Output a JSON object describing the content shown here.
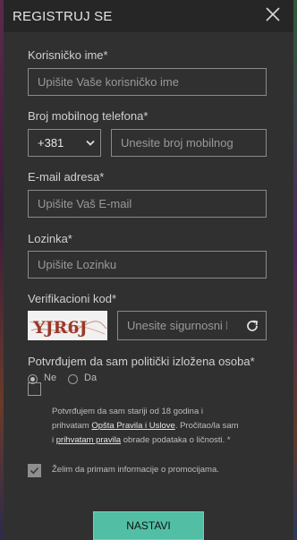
{
  "header": {
    "title": "REGISTRUJ SE"
  },
  "username": {
    "label": "Korisničko ime*",
    "placeholder": "Upišite Vaše korisničko ime"
  },
  "phone": {
    "label": "Broj mobilnog telefona*",
    "country_code": "+381",
    "placeholder": "Unesite broj mobilnog"
  },
  "email": {
    "label": "E-mail adresa*",
    "placeholder": "Upišite Vaš E-mail"
  },
  "password": {
    "label": "Lozinka*",
    "placeholder": "Upišite Lozinku"
  },
  "captcha": {
    "label": "Verifikacioni kod*",
    "image_text": "YJR6J",
    "placeholder": "Unesite sigurnosni kod"
  },
  "pep": {
    "label": "Potvrđujem da sam politički izložena osoba*",
    "option_no": "Ne",
    "option_yes": "Da",
    "selected": "Ne"
  },
  "terms": {
    "line1": "Potvrđujem da sam stariji od 18 godina i",
    "line2_prefix": "prihvatam ",
    "line2_link": "Opšta Pravila i Uslove",
    "line2_suffix": ". Pročitao/la sam",
    "line3_prefix": "i ",
    "line3_link": "prihvatam pravila",
    "line3_suffix": " obrade podataka o ličnosti. *",
    "checked": false
  },
  "promo": {
    "label": "Želim da primam informacije o promocijama.",
    "checked": true
  },
  "submit": {
    "label": "NASTAVI"
  },
  "colors": {
    "accent": "#52bfa5",
    "background": "#303030",
    "header": "#262626"
  }
}
